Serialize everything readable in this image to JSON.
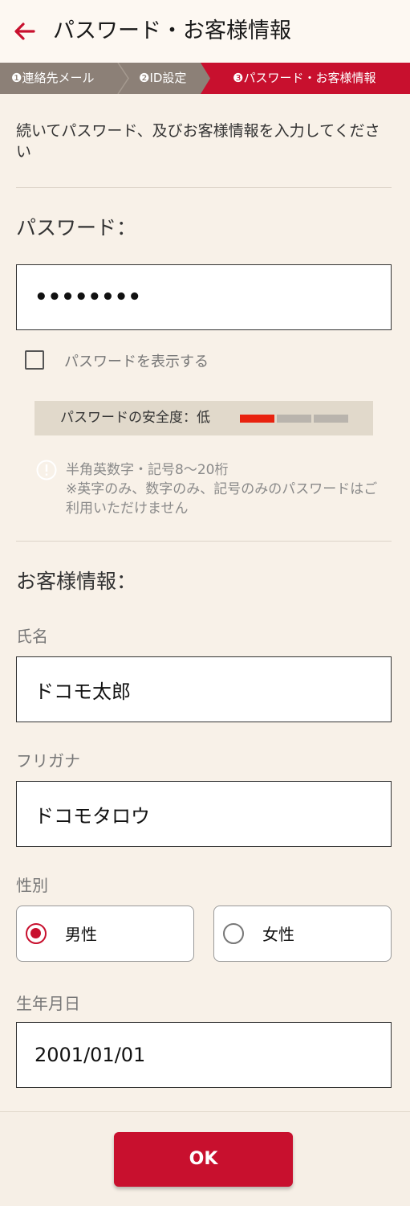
{
  "header": {
    "title": "パスワード・お客様情報",
    "back_icon": "arrow-left-icon"
  },
  "steps": [
    {
      "label": "❶連絡先メール",
      "state": "done"
    },
    {
      "label": "❷ID設定",
      "state": "done"
    },
    {
      "label": "❸パスワード・お客様情報",
      "state": "current"
    }
  ],
  "intro": "続いてパスワード、及びお客様情報を入力してください",
  "password_section": {
    "title": "パスワード：",
    "value": "••••••••",
    "show_password_label": "パスワードを表示する",
    "show_password_checked": false,
    "strength_label": "パスワードの安全度：低",
    "strength_level": "1/3",
    "hint_line1": "半角英数字・記号8〜20桁",
    "hint_line2": "※英字のみ、数字のみ、記号のみのパスワードはご利用いただけません"
  },
  "customer_section": {
    "title": "お客様情報：",
    "name_label": "氏名",
    "name_value": "ドコモ太郎",
    "kana_label": "フリガナ",
    "kana_value": "ドコモタロウ",
    "gender_label": "性別",
    "gender_options": [
      "男性",
      "女性"
    ],
    "gender_selected": "男性",
    "birth_label": "生年月日",
    "birth_value": "2001/01/01"
  },
  "ok_button": "OK",
  "colors": {
    "accent": "#c8102e",
    "background": "#f8f1e8",
    "step_done": "#8c8077",
    "strength_low": "#e8220f",
    "strength_empty": "#b9b4ad"
  }
}
